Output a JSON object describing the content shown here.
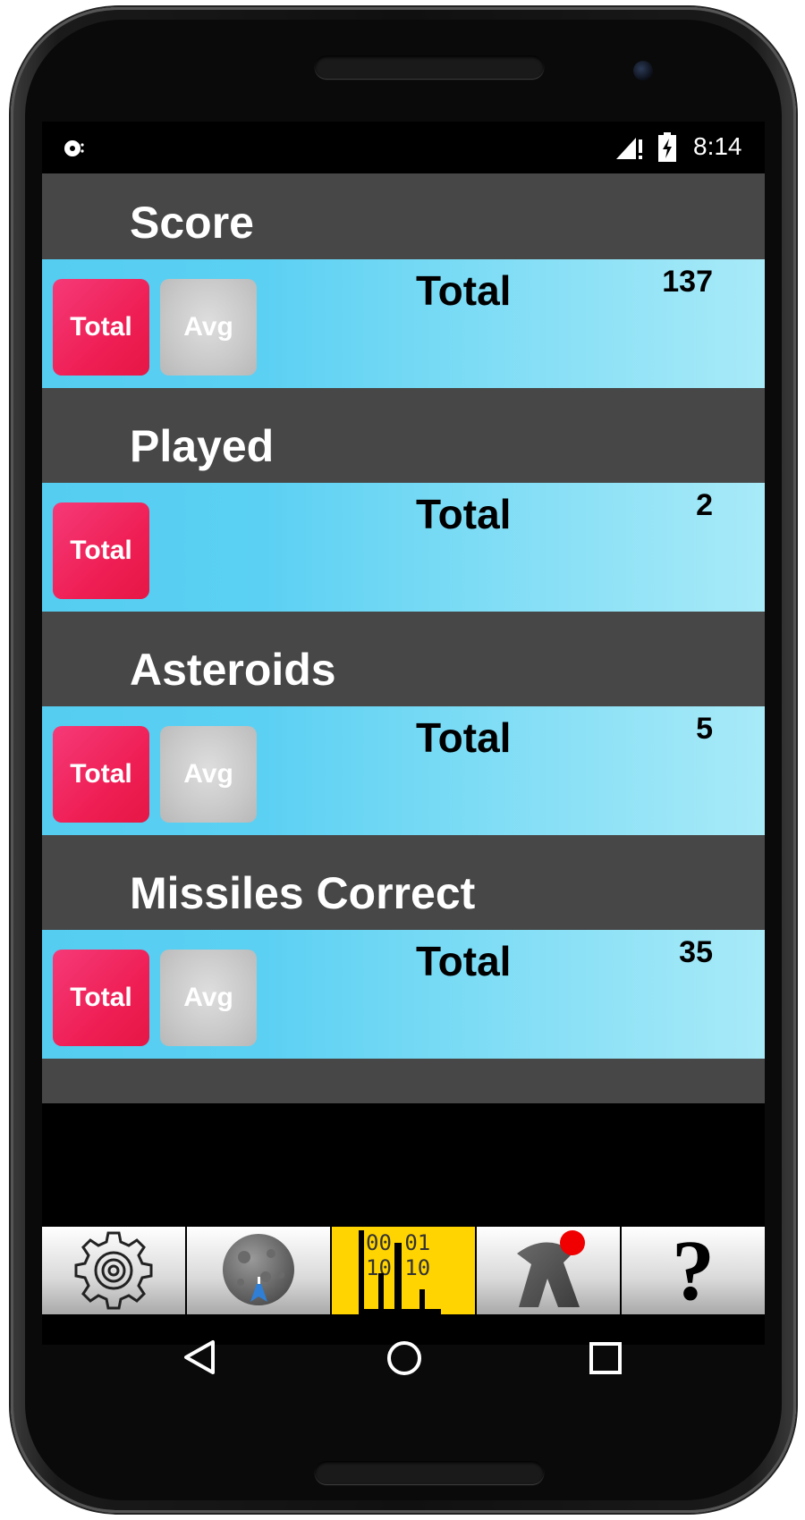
{
  "status_bar": {
    "time": "8:14",
    "left_icon": "notification-disc-icon",
    "signal_icon": "signal-icon",
    "battery_icon": "battery-charging-icon"
  },
  "sections": [
    {
      "title": "Score",
      "row_label": "Total",
      "value": "137",
      "buttons": {
        "total": "Total",
        "avg": "Avg"
      }
    },
    {
      "title": "Played",
      "row_label": "Total",
      "value": "2",
      "buttons": {
        "total": "Total"
      }
    },
    {
      "title": "Asteroids",
      "row_label": "Total",
      "value": "5",
      "buttons": {
        "total": "Total",
        "avg": "Avg"
      }
    },
    {
      "title": "Missiles Correct",
      "row_label": "Total",
      "value": "35",
      "buttons": {
        "total": "Total",
        "avg": "Avg"
      }
    }
  ],
  "toolbar": {
    "items": [
      {
        "icon": "gear-icon"
      },
      {
        "icon": "asteroid-game-icon"
      },
      {
        "icon": "stats-binary-icon",
        "active": true,
        "digits_top": "00 01",
        "digits_bottom": "10 10"
      },
      {
        "icon": "badge-notification-icon"
      },
      {
        "icon": "help-icon",
        "glyph": "?"
      }
    ]
  },
  "navbar": {
    "back_icon": "back-triangle-icon",
    "home_icon": "home-circle-icon",
    "recents_icon": "recents-square-icon"
  },
  "colors": {
    "section_bg": "#474747",
    "row_gradient_start": "#54cdf1",
    "row_gradient_end": "#a8eaf8",
    "total_button": "#ef1f55",
    "avg_button": "#c8c8c8",
    "active_tool": "#ffd400"
  }
}
